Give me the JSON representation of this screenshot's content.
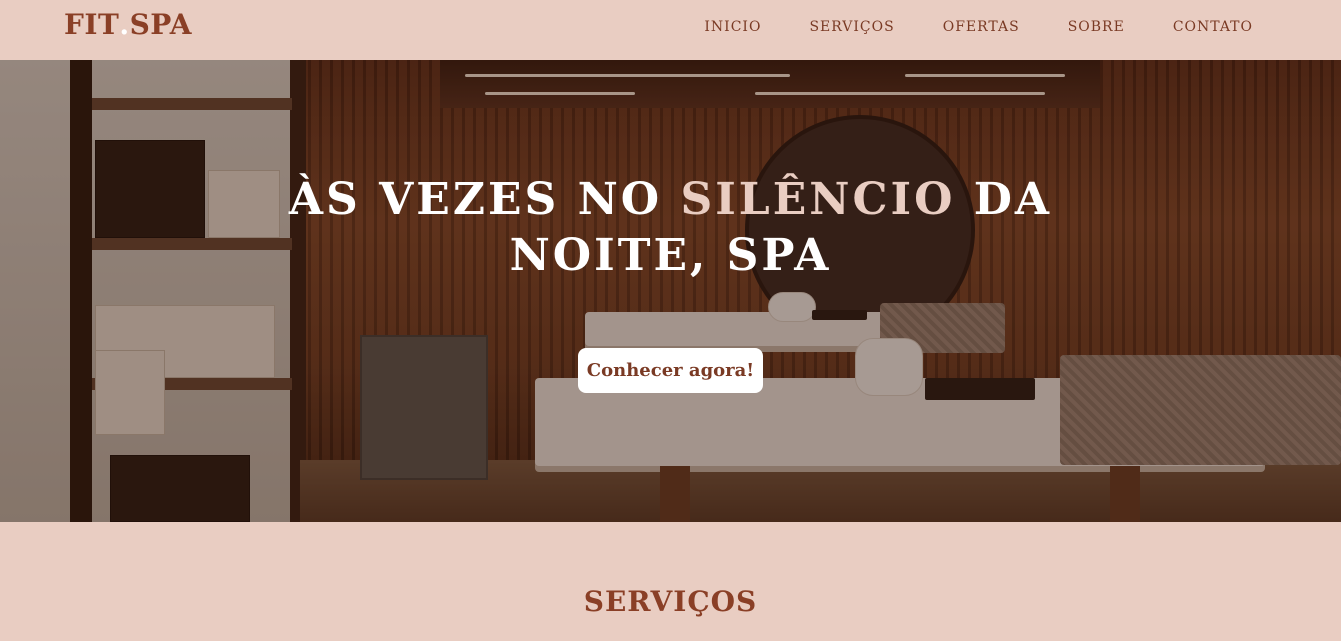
{
  "brand": {
    "logo_part1": "FIT",
    "logo_dot": ".",
    "logo_part2": "SPA"
  },
  "nav": {
    "items": [
      {
        "label": "INICIO"
      },
      {
        "label": "SERVIÇOS"
      },
      {
        "label": "OFERTAS"
      },
      {
        "label": "SOBRE"
      },
      {
        "label": "CONTATO"
      }
    ]
  },
  "hero": {
    "title_part1": "ÀS VEZES NO ",
    "title_accent": "SILÊNCIO",
    "title_part2": " DA",
    "title_line2": "NOITE, SPA",
    "cta_label": "Conhecer agora!"
  },
  "services": {
    "title": "SERVIÇOS"
  },
  "colors": {
    "background": "#e9cdc2",
    "brand": "#8a3f26",
    "hero_accent": "#e9cdc2",
    "button_bg": "#ffffff"
  }
}
